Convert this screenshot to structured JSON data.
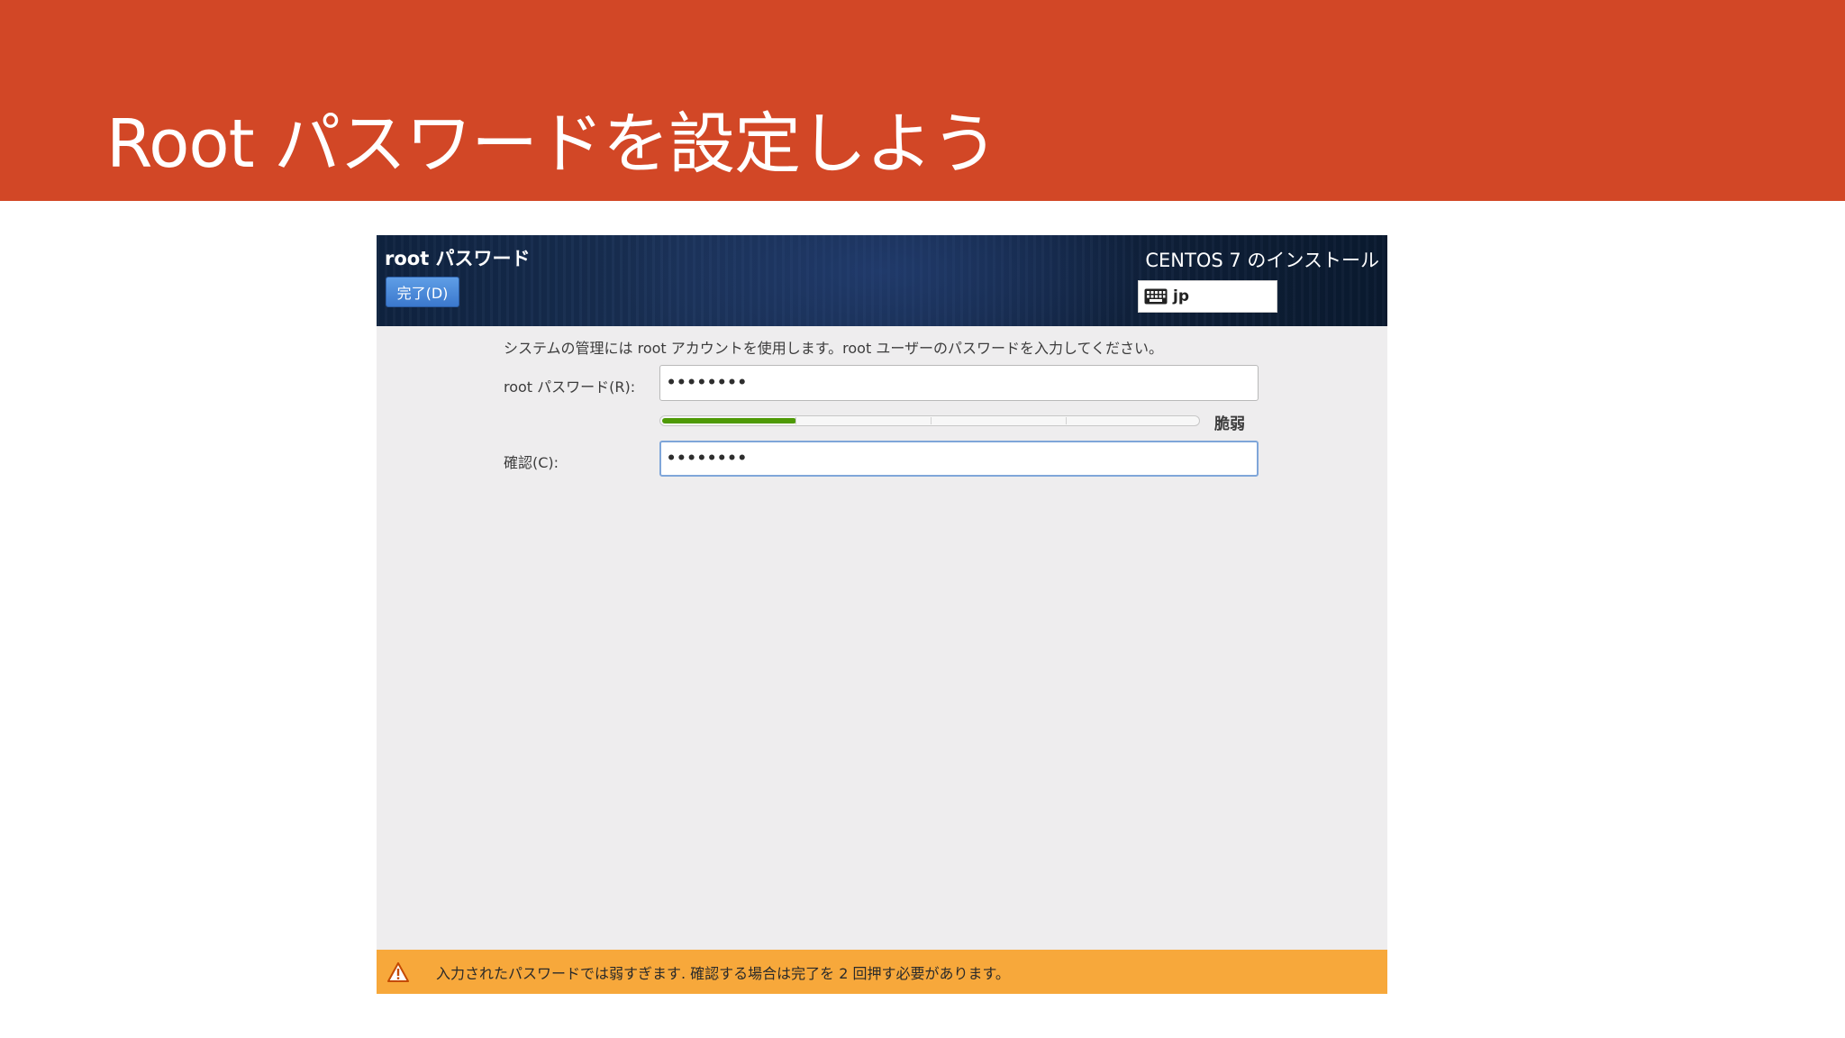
{
  "slide": {
    "title": "Root パスワードを設定しよう",
    "banner_color": "#d24726"
  },
  "installer": {
    "spoke_title": "root パスワード",
    "done_button_label": "完了(D)",
    "product_title": "CENTOS 7 のインストール",
    "keyboard": {
      "icon": "keyboard-icon",
      "layout": "jp"
    },
    "description": "システムの管理には root アカウントを使用します。root ユーザーのパスワードを入力してください。",
    "password": {
      "label": "root パスワード(R):",
      "value": "••••••••"
    },
    "strength": {
      "fraction": 0.25,
      "label": "脆弱",
      "color": "#4e9a06"
    },
    "confirm": {
      "label": "確認(C):",
      "value": "••••••••"
    },
    "warning": {
      "icon": "warning-icon",
      "text": "入力されたパスワードでは弱すぎます. 確認する場合は完了を 2 回押す必要があります。",
      "color": "#f7a83b"
    }
  }
}
